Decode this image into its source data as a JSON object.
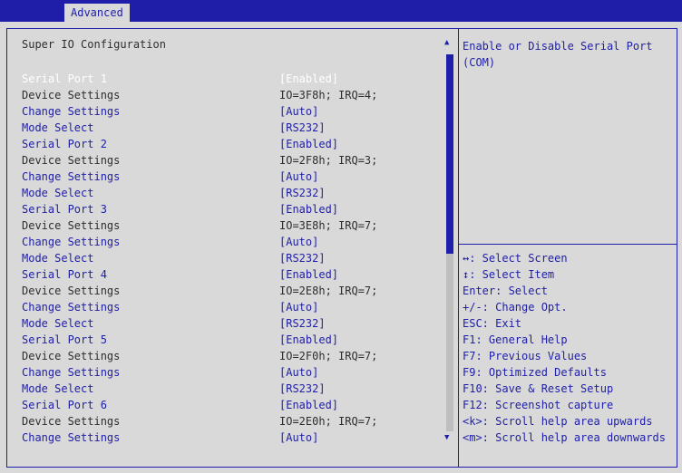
{
  "tabs": {
    "active": "Advanced"
  },
  "section_title": "Super IO Configuration",
  "rows": [
    {
      "label": "Serial Port 1",
      "value": "[Enabled]",
      "kind": "selected"
    },
    {
      "label": "Device Settings",
      "value": "IO=3F8h; IRQ=4;",
      "kind": "info"
    },
    {
      "label": "Change Settings",
      "value": "[Auto]",
      "kind": "link"
    },
    {
      "label": "Mode Select",
      "value": "[RS232]",
      "kind": "link"
    },
    {
      "label": "Serial Port 2",
      "value": "[Enabled]",
      "kind": "link"
    },
    {
      "label": "Device Settings",
      "value": "IO=2F8h; IRQ=3;",
      "kind": "info"
    },
    {
      "label": "Change Settings",
      "value": "[Auto]",
      "kind": "link"
    },
    {
      "label": "Mode Select",
      "value": "[RS232]",
      "kind": "link"
    },
    {
      "label": "Serial Port 3",
      "value": "[Enabled]",
      "kind": "link"
    },
    {
      "label": "Device Settings",
      "value": "IO=3E8h; IRQ=7;",
      "kind": "info"
    },
    {
      "label": "Change Settings",
      "value": "[Auto]",
      "kind": "link"
    },
    {
      "label": "Mode Select",
      "value": "[RS232]",
      "kind": "link"
    },
    {
      "label": "Serial Port 4",
      "value": "[Enabled]",
      "kind": "link"
    },
    {
      "label": "Device Settings",
      "value": "IO=2E8h; IRQ=7;",
      "kind": "info"
    },
    {
      "label": "Change Settings",
      "value": "[Auto]",
      "kind": "link"
    },
    {
      "label": "Mode Select",
      "value": "[RS232]",
      "kind": "link"
    },
    {
      "label": "Serial Port 5",
      "value": "[Enabled]",
      "kind": "link"
    },
    {
      "label": "Device Settings",
      "value": "IO=2F0h; IRQ=7;",
      "kind": "info"
    },
    {
      "label": "Change Settings",
      "value": "[Auto]",
      "kind": "link"
    },
    {
      "label": "Mode Select",
      "value": "[RS232]",
      "kind": "link"
    },
    {
      "label": "Serial Port 6",
      "value": "[Enabled]",
      "kind": "link"
    },
    {
      "label": "Device Settings",
      "value": "IO=2E0h; IRQ=7;",
      "kind": "info"
    },
    {
      "label": "Change Settings",
      "value": "[Auto]",
      "kind": "link"
    }
  ],
  "help_text": "Enable or Disable Serial Port (COM)",
  "key_help": [
    "↔: Select Screen",
    "↕: Select Item",
    "Enter: Select",
    "+/-: Change Opt.",
    "ESC: Exit",
    "F1: General Help",
    "F7: Previous Values",
    "F9: Optimized Defaults",
    "F10: Save & Reset Setup",
    "F12: Screenshot capture",
    "<k>: Scroll help area upwards",
    "<m>: Scroll help area downwards"
  ],
  "icons": {
    "scroll_up": "triangle-up-icon",
    "scroll_down": "triangle-down-icon"
  },
  "colors": {
    "accent": "#1e1ea8",
    "background": "#d9d9d9",
    "info_text": "#2e2e2e",
    "selected_text": "#ffffff"
  }
}
